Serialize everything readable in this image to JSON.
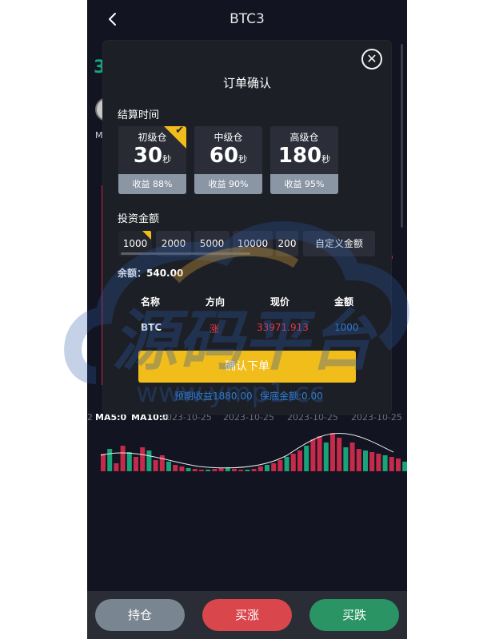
{
  "header": {
    "back_glyph": "‹",
    "title": "BTC3"
  },
  "background": {
    "partial_price": "3",
    "ma_indicator": "M",
    "volume_indicators": [
      "MA5:0",
      "MA10:0"
    ],
    "dates": [
      "2023-10-25",
      "2023-10-25",
      "2023-10-25",
      "2023-10-25"
    ],
    "edge_date_fragment": "2"
  },
  "modal": {
    "close_glyph": "✕",
    "title": "订单确认",
    "settlement_label": "结算时间",
    "plans": [
      {
        "name": "初级仓",
        "seconds": "30",
        "unit": "秒",
        "income": "收益 88%",
        "selected": true
      },
      {
        "name": "中级仓",
        "seconds": "60",
        "unit": "秒",
        "income": "收益 90%",
        "selected": false
      },
      {
        "name": "高级仓",
        "seconds": "180",
        "unit": "秒",
        "income": "收益 95%",
        "selected": false
      }
    ],
    "invest_label": "投资金额",
    "amounts": [
      "1000",
      "2000",
      "5000",
      "10000",
      "200"
    ],
    "custom_amount_label": "自定义金额",
    "balance": "余额：540.00",
    "order_table": {
      "headers": [
        "名称",
        "方向",
        "现价",
        "金额"
      ],
      "row": {
        "name": "BTC",
        "direction": "涨",
        "price": "33971.913",
        "amount": "1000"
      }
    },
    "confirm_label": "确认下单",
    "expected_income": "预期收益1880.00",
    "margin": "保底金额:0.00"
  },
  "bottom_bar": {
    "hold_label": "持仓",
    "buy_up_label": "买涨",
    "buy_down_label": "买跌"
  },
  "watermark": {
    "text": "源码平台",
    "url": "www.ymp1.cc"
  },
  "colors": {
    "accent_yellow": "#f1bd1a",
    "up_red": "#d9474d",
    "down_green": "#2a9464",
    "hold_gray": "#7a8592",
    "link_blue": "#2f7fd6",
    "price_red": "#e23a4a"
  }
}
